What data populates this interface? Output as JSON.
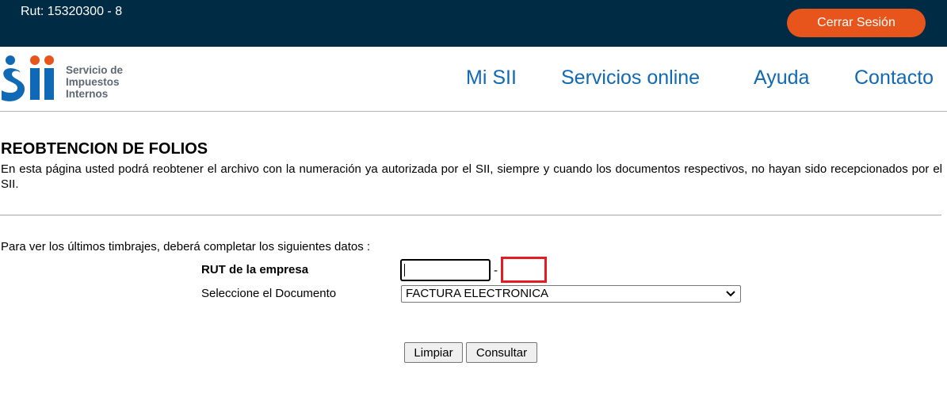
{
  "header": {
    "rut_text": "Rut: 15320300 - 8",
    "logout_label": "Cerrar Sesión"
  },
  "logo": {
    "lines": [
      "Servicio de",
      "Impuestos",
      "Internos"
    ],
    "colors": {
      "primary": "#0f69b4",
      "accent": "#e8551c",
      "text": "#5d6874"
    }
  },
  "nav": {
    "items": [
      "Mi SII",
      "Servicios online",
      "Ayuda",
      "Contacto"
    ]
  },
  "page": {
    "title": "REOBTENCION DE FOLIOS",
    "description": "En esta página usted podrá reobtener el archivo con la numeración ya autorizada por el SII, siempre y cuando los documentos respectivos, no hayan sido recepcionados por el SII.",
    "instructions": "Para ver los últimos timbrajes, deberá completar los siguientes datos :"
  },
  "form": {
    "rut_label": "RUT de la empresa",
    "rut_value": "",
    "rut_separator": "-",
    "dv_value": "",
    "doc_label": "Seleccione el Documento",
    "doc_selected": "FACTURA ELECTRONICA",
    "clear_label": "Limpiar",
    "submit_label": "Consultar"
  },
  "colors": {
    "topbar": "#002b45",
    "logout_button": "#e8551c",
    "nav_link": "#0f69b4",
    "highlight_border": "#e31b23"
  }
}
